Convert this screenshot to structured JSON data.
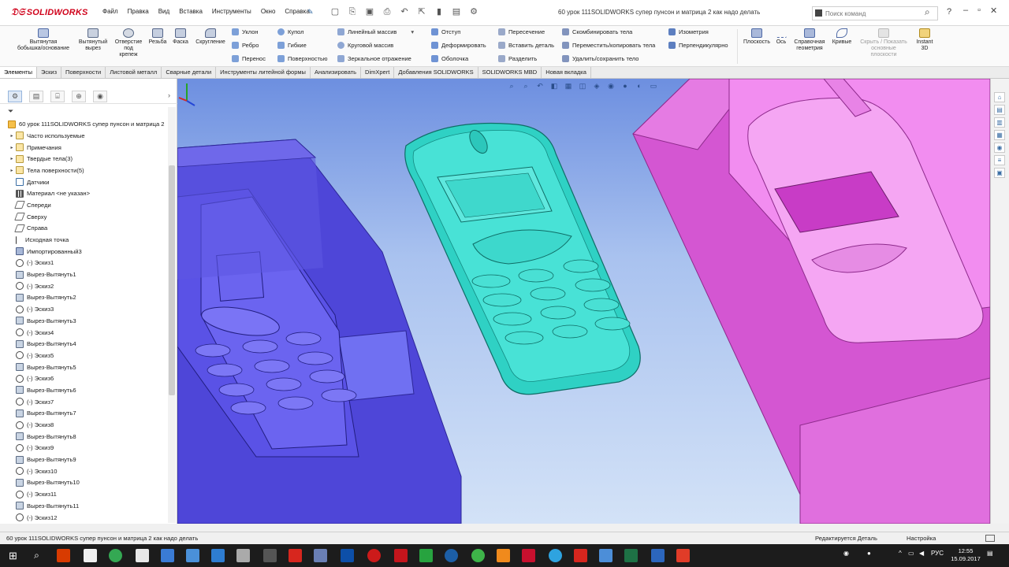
{
  "app": {
    "logo_text": "SOLIDWORKS",
    "document_title": "60 урок 111SOLIDWORKS супер пунсон и матрица 2 как надо делать",
    "search_placeholder": "Поиск команд"
  },
  "menu": [
    "Файл",
    "Правка",
    "Вид",
    "Вставка",
    "Инструменты",
    "Окно",
    "Справка"
  ],
  "ribbon": {
    "big_tools": [
      {
        "label": "Вытянутая\nбобышка/основание"
      },
      {
        "label": "Вытянутый\nвырез"
      },
      {
        "label": "Отверстие\nпод\nкрепеж"
      },
      {
        "label": "Резьба"
      },
      {
        "label": "Фаска"
      },
      {
        "label": "Скругление"
      }
    ],
    "group1": [
      "Уклон",
      "Ребро",
      "Перенос"
    ],
    "group2": [
      "Купол",
      "Гибкие",
      "Поверхностью"
    ],
    "group3": [
      "Линейный массив",
      "Круговой массив",
      "Зеркальное отражение"
    ],
    "group4": [
      "Отступ",
      "Деформировать",
      "Оболочка"
    ],
    "group5": [
      "Пересечение",
      "Вставить деталь",
      "Разделить"
    ],
    "group6": [
      "Скомбинировать тела",
      "Переместить/копировать тела",
      "Удалить/сохранить тело"
    ],
    "group7": [
      "Изометрия",
      "Перпендикулярно"
    ],
    "right_tools": [
      {
        "label": "Плоскость"
      },
      {
        "label": "Ось"
      },
      {
        "label": "Справочная\nгеометрия"
      },
      {
        "label": "Кривые"
      },
      {
        "label": "Скрыть / Показать\nосновные\nплоскости"
      },
      {
        "label": "Instant\n3D"
      }
    ]
  },
  "tabs": [
    {
      "label": "Элементы",
      "active": true
    },
    {
      "label": "Эскиз",
      "active": false
    },
    {
      "label": "Поверхности",
      "active": false
    },
    {
      "label": "Листовой металл",
      "active": false
    },
    {
      "label": "Сварные детали",
      "active": false
    },
    {
      "label": "Инструменты литейной формы",
      "active": false
    },
    {
      "label": "Анализировать",
      "active": false
    },
    {
      "label": "DimXpert",
      "active": false
    },
    {
      "label": "Добавления SOLIDWORKS",
      "active": false
    },
    {
      "label": "SOLIDWORKS MBD",
      "active": false
    },
    {
      "label": "Новая вкладка",
      "active": false
    }
  ],
  "tree": {
    "root": "60 урок 111SOLIDWORKS супер пунсон и матрица 2",
    "items": [
      {
        "label": "Часто используемые",
        "kind": "folder",
        "exp": true
      },
      {
        "label": "Примечания",
        "kind": "folder",
        "exp": true
      },
      {
        "label": "Твердые тела(3)",
        "kind": "folder",
        "exp": true
      },
      {
        "label": "Тела поверхности(5)",
        "kind": "folder",
        "exp": true
      },
      {
        "label": "Датчики",
        "kind": "sensor",
        "exp": false
      },
      {
        "label": "Материал <не указан>",
        "kind": "mat",
        "exp": false
      },
      {
        "label": "Спереди",
        "kind": "plane",
        "exp": false
      },
      {
        "label": "Сверху",
        "kind": "plane",
        "exp": false
      },
      {
        "label": "Справа",
        "kind": "plane",
        "exp": false
      },
      {
        "label": "Исходная точка",
        "kind": "origin",
        "exp": false
      },
      {
        "label": "Импортированный3",
        "kind": "imp",
        "exp": false
      },
      {
        "label": "(-) Эскиз1",
        "kind": "sketch",
        "exp": false
      },
      {
        "label": "Вырез-Вытянуть1",
        "kind": "cut",
        "exp": false
      },
      {
        "label": "(-) Эскиз2",
        "kind": "sketch",
        "exp": false
      },
      {
        "label": "Вырез-Вытянуть2",
        "kind": "cut",
        "exp": false
      },
      {
        "label": "(-) Эскиз3",
        "kind": "sketch",
        "exp": false
      },
      {
        "label": "Вырез-Вытянуть3",
        "kind": "cut",
        "exp": false
      },
      {
        "label": "(-) Эскиз4",
        "kind": "sketch",
        "exp": false
      },
      {
        "label": "Вырез-Вытянуть4",
        "kind": "cut",
        "exp": false
      },
      {
        "label": "(-) Эскиз5",
        "kind": "sketch",
        "exp": false
      },
      {
        "label": "Вырез-Вытянуть5",
        "kind": "cut",
        "exp": false
      },
      {
        "label": "(-) Эскиз6",
        "kind": "sketch",
        "exp": false
      },
      {
        "label": "Вырез-Вытянуть6",
        "kind": "cut",
        "exp": false
      },
      {
        "label": "(-) Эскиз7",
        "kind": "sketch",
        "exp": false
      },
      {
        "label": "Вырез-Вытянуть7",
        "kind": "cut",
        "exp": false
      },
      {
        "label": "(-) Эскиз8",
        "kind": "sketch",
        "exp": false
      },
      {
        "label": "Вырез-Вытянуть8",
        "kind": "cut",
        "exp": false
      },
      {
        "label": "(-) Эскиз9",
        "kind": "sketch",
        "exp": false
      },
      {
        "label": "Вырез-Вытянуть9",
        "kind": "cut",
        "exp": false
      },
      {
        "label": "(-) Эскиз10",
        "kind": "sketch",
        "exp": false
      },
      {
        "label": "Вырез-Вытянуть10",
        "kind": "cut",
        "exp": false
      },
      {
        "label": "(-) Эскиз11",
        "kind": "sketch",
        "exp": false
      },
      {
        "label": "Вырез-Вытянуть11",
        "kind": "cut",
        "exp": false
      },
      {
        "label": "(-) Эскиз12",
        "kind": "sketch",
        "exp": false
      }
    ]
  },
  "status": {
    "left": "60 урок 111SOLIDWORKS супер пунсон и матрица 2 как надо делать",
    "mode": "Редактируется Деталь",
    "config": "Настройка"
  },
  "tray": {
    "lang": "РУС",
    "time": "12:55",
    "date": "15.09.2017"
  },
  "colors": {
    "brand": "#d0021b",
    "left_mold": "#5b52e0",
    "phone": "#35d6c8",
    "right_mold": "#e56ae3"
  }
}
